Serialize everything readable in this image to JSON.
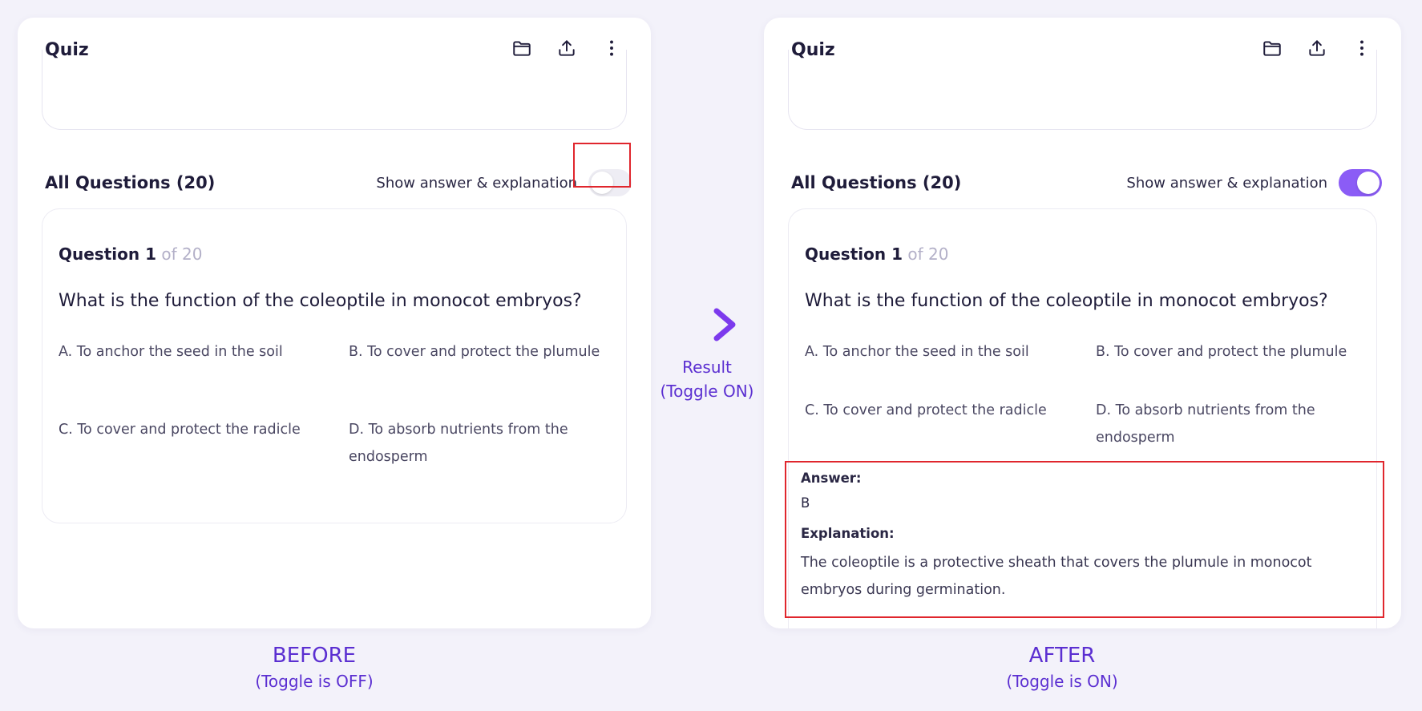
{
  "before": {
    "header": {
      "title": "Quiz"
    },
    "section": {
      "title": "All Questions (20)",
      "toggle_label": "Show answer & explanation"
    },
    "question": {
      "number": "Question 1",
      "of": " of 20",
      "text": "What is the function of the coleoptile in monocot embryos?",
      "options": {
        "a": "A.  To anchor the seed in the soil",
        "b": "B.  To cover and protect the plumule",
        "c": "C.  To cover and protect the radicle",
        "d1": "D.  To absorb nutrients from the",
        "d2": "endosperm"
      }
    }
  },
  "after": {
    "header": {
      "title": "Quiz"
    },
    "section": {
      "title": "All Questions (20)",
      "toggle_label": "Show answer & explanation"
    },
    "question": {
      "number": "Question 1",
      "of": " of 20",
      "text": "What is the function of the coleoptile in monocot embryos?",
      "options": {
        "a": "A.  To anchor the seed in the soil",
        "b": "B.  To cover and protect the plumule",
        "c": "C.  To cover and protect the radicle",
        "d": "D.  To absorb nutrients from the endosperm"
      }
    },
    "answer": {
      "label": "Answer:",
      "value": "B",
      "explanation_label": "Explanation:",
      "explanation": "The coleoptile is a protective sheath that covers the plumule in monocot embryos during germination."
    }
  },
  "annotations": {
    "result_line1": "Result",
    "result_line2": "(Toggle ON)",
    "before_caption": "BEFORE",
    "before_sub": "(Toggle is OFF)",
    "after_caption": "AFTER",
    "after_sub": "(Toggle is ON)"
  },
  "icons": [
    "folder-icon",
    "upload-icon",
    "more-vertical-icon",
    "arrow-right-icon"
  ],
  "colors": {
    "accent": "#8b5cf6",
    "annotation_text": "#5b2fd1",
    "highlight_border": "#e0262d",
    "background": "#f3f2fa"
  },
  "toggle_state": {
    "before": false,
    "after": true
  }
}
